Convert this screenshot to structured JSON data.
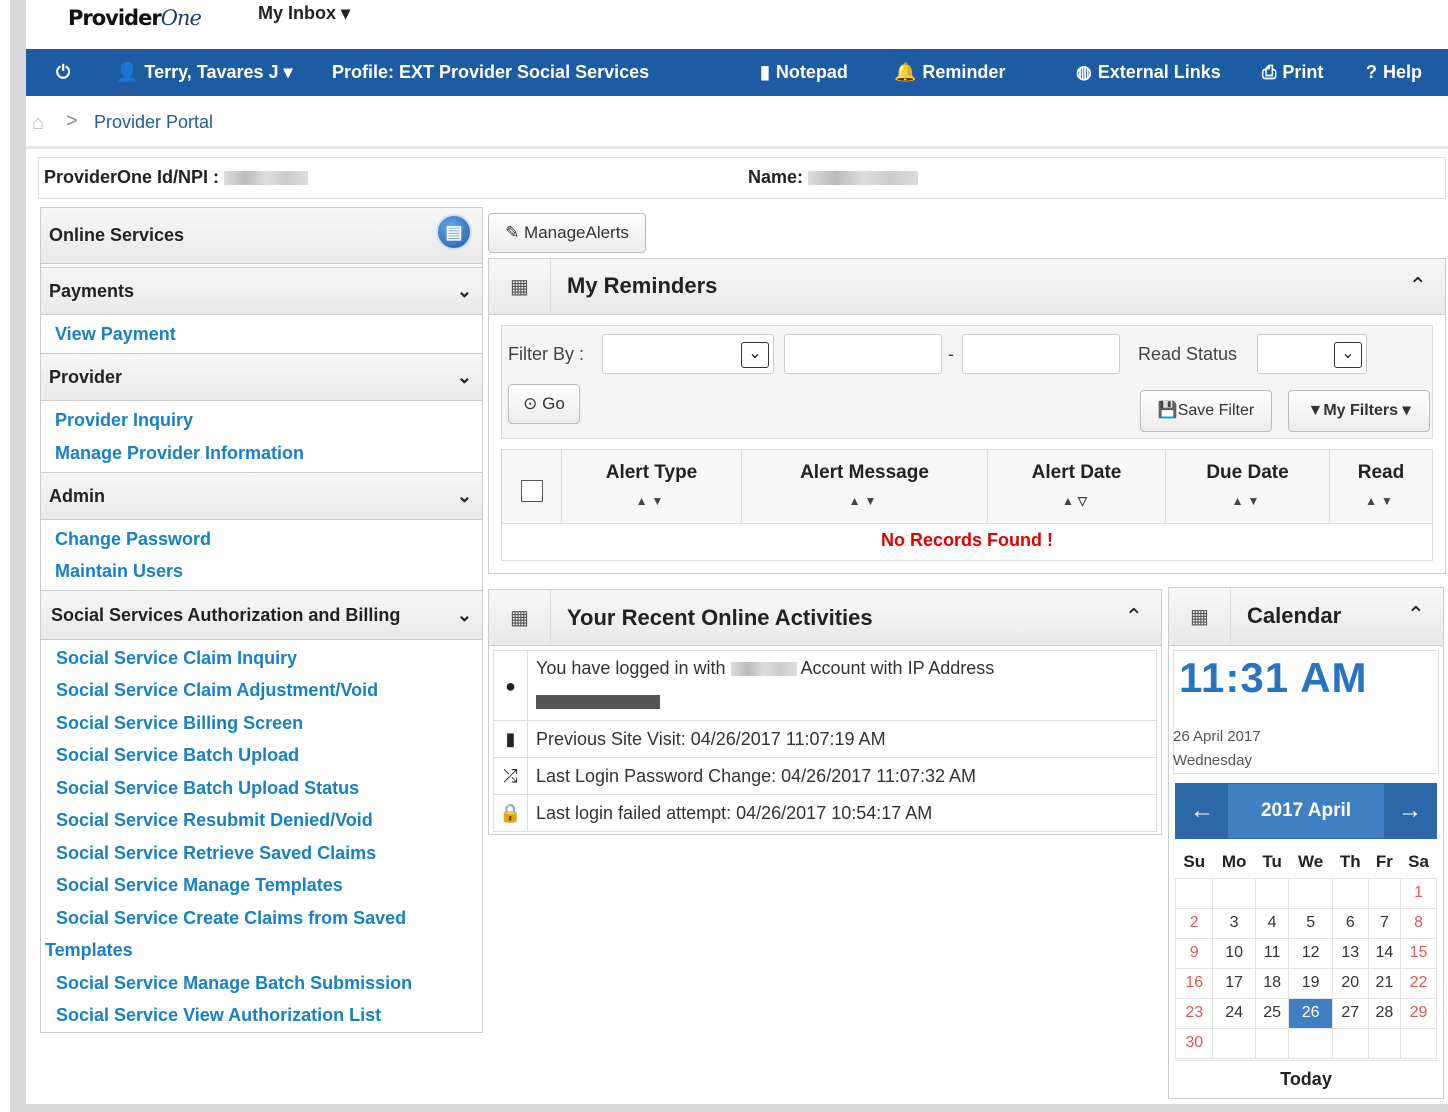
{
  "app": {
    "logo_text": "Provider",
    "logo_suffix": "One",
    "inbox_label": "My Inbox",
    "inbox_caret": "▾"
  },
  "nav": {
    "power_icon": "power-icon",
    "user_label": "Terry, Tavares J",
    "user_caret": "▾",
    "profile_label": "Profile: EXT Provider Social Services",
    "notepad_label": "Notepad",
    "reminder_label": "Reminder",
    "external_links_label": "External Links",
    "print_label": "Print",
    "help_label": "Help",
    "bar_color": "#1d5ca3"
  },
  "breadcrumb": {
    "home_icon": "home-icon",
    "separator": ">",
    "current": "Provider Portal"
  },
  "provider_info": {
    "id_label": "ProviderOne Id/NPI :",
    "name_label": "Name:"
  },
  "sidebar": {
    "title": "Online Services",
    "sections": [
      {
        "title": "Payments",
        "items": [
          "View Payment"
        ]
      },
      {
        "title": "Provider",
        "items": [
          "Provider Inquiry",
          "Manage Provider Information"
        ]
      },
      {
        "title": "Admin",
        "items": [
          "Change Password",
          "Maintain Users"
        ]
      },
      {
        "title": "Social Services Authorization and Billing",
        "items": [
          "Social Service Claim Inquiry",
          "Social Service Claim Adjustment/Void",
          "Social Service Billing Screen",
          "Social Service Batch Upload",
          "Social Service Batch Upload Status",
          "Social Service Resubmit Denied/Void",
          "Social Service Retrieve Saved Claims",
          "Social Service Manage Templates",
          "Social Service Create Claims from Saved",
          "Templates",
          "Social Service Manage Batch Submission",
          "Social Service View Authorization List"
        ]
      }
    ],
    "link_color": "#1780c8"
  },
  "alerts": {
    "manage_label": "ManageAlerts"
  },
  "reminders": {
    "title": "My Reminders",
    "filter_label": "Filter By :",
    "dash": "-",
    "read_status_label": "Read Status",
    "go_label": "Go",
    "save_filter_label": "Save Filter",
    "my_filters_label": "My Filters",
    "columns": [
      "Alert Type",
      "Alert Message",
      "Alert Date",
      "Due Date",
      "Read"
    ],
    "empty_message": "No Records Found !",
    "empty_color": "#e00000"
  },
  "activities": {
    "title": "Your Recent Online Activities",
    "login_prefix": "You have logged in with",
    "login_suffix": "Account with IP Address",
    "previous_visit": "Previous Site Visit: 04/26/2017 11:07:19 AM",
    "password_change": "Last Login Password Change: 04/26/2017 11:07:32 AM",
    "failed_attempt": "Last login failed attempt: 04/26/2017 10:54:17 AM"
  },
  "calendar": {
    "title": "Calendar",
    "time": "11:31 AM",
    "date": "26 April 2017",
    "weekday": "Wednesday",
    "month_label": "2017 April",
    "prev": "←",
    "next": "→",
    "days_header": [
      "Su",
      "Mo",
      "Tu",
      "We",
      "Th",
      "Fr",
      "Sa"
    ],
    "weeks": [
      [
        "",
        "",
        "",
        "",
        "",
        "",
        "1"
      ],
      [
        "2",
        "3",
        "4",
        "5",
        "6",
        "7",
        "8"
      ],
      [
        "9",
        "10",
        "11",
        "12",
        "13",
        "14",
        "15"
      ],
      [
        "16",
        "17",
        "18",
        "19",
        "20",
        "21",
        "22"
      ],
      [
        "23",
        "24",
        "25",
        "26",
        "27",
        "28",
        "29"
      ],
      [
        "30",
        "",
        "",
        "",
        "",
        "",
        ""
      ]
    ],
    "selected_day": "26",
    "today_label": "Today",
    "accent": "#3f7fc2"
  }
}
